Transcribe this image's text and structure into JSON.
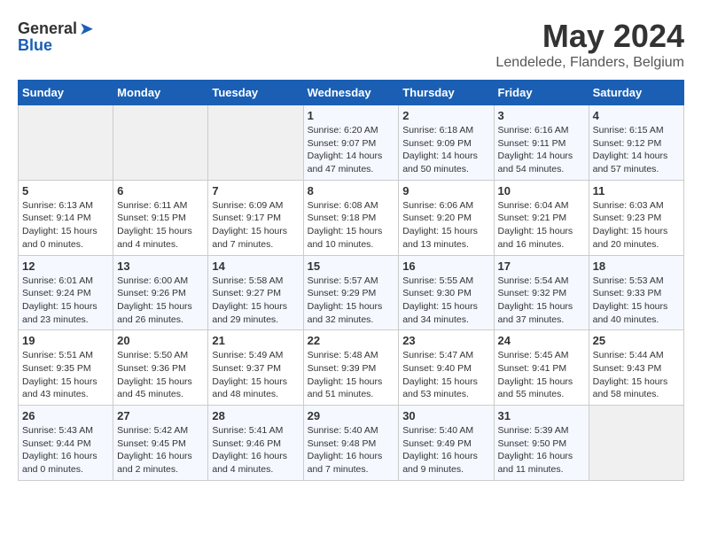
{
  "logo": {
    "general": "General",
    "blue": "Blue"
  },
  "title": "May 2024",
  "location": "Lendelede, Flanders, Belgium",
  "days_header": [
    "Sunday",
    "Monday",
    "Tuesday",
    "Wednesday",
    "Thursday",
    "Friday",
    "Saturday"
  ],
  "weeks": [
    [
      {
        "day": "",
        "info": ""
      },
      {
        "day": "",
        "info": ""
      },
      {
        "day": "",
        "info": ""
      },
      {
        "day": "1",
        "info": "Sunrise: 6:20 AM\nSunset: 9:07 PM\nDaylight: 14 hours and 47 minutes."
      },
      {
        "day": "2",
        "info": "Sunrise: 6:18 AM\nSunset: 9:09 PM\nDaylight: 14 hours and 50 minutes."
      },
      {
        "day": "3",
        "info": "Sunrise: 6:16 AM\nSunset: 9:11 PM\nDaylight: 14 hours and 54 minutes."
      },
      {
        "day": "4",
        "info": "Sunrise: 6:15 AM\nSunset: 9:12 PM\nDaylight: 14 hours and 57 minutes."
      }
    ],
    [
      {
        "day": "5",
        "info": "Sunrise: 6:13 AM\nSunset: 9:14 PM\nDaylight: 15 hours and 0 minutes."
      },
      {
        "day": "6",
        "info": "Sunrise: 6:11 AM\nSunset: 9:15 PM\nDaylight: 15 hours and 4 minutes."
      },
      {
        "day": "7",
        "info": "Sunrise: 6:09 AM\nSunset: 9:17 PM\nDaylight: 15 hours and 7 minutes."
      },
      {
        "day": "8",
        "info": "Sunrise: 6:08 AM\nSunset: 9:18 PM\nDaylight: 15 hours and 10 minutes."
      },
      {
        "day": "9",
        "info": "Sunrise: 6:06 AM\nSunset: 9:20 PM\nDaylight: 15 hours and 13 minutes."
      },
      {
        "day": "10",
        "info": "Sunrise: 6:04 AM\nSunset: 9:21 PM\nDaylight: 15 hours and 16 minutes."
      },
      {
        "day": "11",
        "info": "Sunrise: 6:03 AM\nSunset: 9:23 PM\nDaylight: 15 hours and 20 minutes."
      }
    ],
    [
      {
        "day": "12",
        "info": "Sunrise: 6:01 AM\nSunset: 9:24 PM\nDaylight: 15 hours and 23 minutes."
      },
      {
        "day": "13",
        "info": "Sunrise: 6:00 AM\nSunset: 9:26 PM\nDaylight: 15 hours and 26 minutes."
      },
      {
        "day": "14",
        "info": "Sunrise: 5:58 AM\nSunset: 9:27 PM\nDaylight: 15 hours and 29 minutes."
      },
      {
        "day": "15",
        "info": "Sunrise: 5:57 AM\nSunset: 9:29 PM\nDaylight: 15 hours and 32 minutes."
      },
      {
        "day": "16",
        "info": "Sunrise: 5:55 AM\nSunset: 9:30 PM\nDaylight: 15 hours and 34 minutes."
      },
      {
        "day": "17",
        "info": "Sunrise: 5:54 AM\nSunset: 9:32 PM\nDaylight: 15 hours and 37 minutes."
      },
      {
        "day": "18",
        "info": "Sunrise: 5:53 AM\nSunset: 9:33 PM\nDaylight: 15 hours and 40 minutes."
      }
    ],
    [
      {
        "day": "19",
        "info": "Sunrise: 5:51 AM\nSunset: 9:35 PM\nDaylight: 15 hours and 43 minutes."
      },
      {
        "day": "20",
        "info": "Sunrise: 5:50 AM\nSunset: 9:36 PM\nDaylight: 15 hours and 45 minutes."
      },
      {
        "day": "21",
        "info": "Sunrise: 5:49 AM\nSunset: 9:37 PM\nDaylight: 15 hours and 48 minutes."
      },
      {
        "day": "22",
        "info": "Sunrise: 5:48 AM\nSunset: 9:39 PM\nDaylight: 15 hours and 51 minutes."
      },
      {
        "day": "23",
        "info": "Sunrise: 5:47 AM\nSunset: 9:40 PM\nDaylight: 15 hours and 53 minutes."
      },
      {
        "day": "24",
        "info": "Sunrise: 5:45 AM\nSunset: 9:41 PM\nDaylight: 15 hours and 55 minutes."
      },
      {
        "day": "25",
        "info": "Sunrise: 5:44 AM\nSunset: 9:43 PM\nDaylight: 15 hours and 58 minutes."
      }
    ],
    [
      {
        "day": "26",
        "info": "Sunrise: 5:43 AM\nSunset: 9:44 PM\nDaylight: 16 hours and 0 minutes."
      },
      {
        "day": "27",
        "info": "Sunrise: 5:42 AM\nSunset: 9:45 PM\nDaylight: 16 hours and 2 minutes."
      },
      {
        "day": "28",
        "info": "Sunrise: 5:41 AM\nSunset: 9:46 PM\nDaylight: 16 hours and 4 minutes."
      },
      {
        "day": "29",
        "info": "Sunrise: 5:40 AM\nSunset: 9:48 PM\nDaylight: 16 hours and 7 minutes."
      },
      {
        "day": "30",
        "info": "Sunrise: 5:40 AM\nSunset: 9:49 PM\nDaylight: 16 hours and 9 minutes."
      },
      {
        "day": "31",
        "info": "Sunrise: 5:39 AM\nSunset: 9:50 PM\nDaylight: 16 hours and 11 minutes."
      },
      {
        "day": "",
        "info": ""
      }
    ]
  ]
}
